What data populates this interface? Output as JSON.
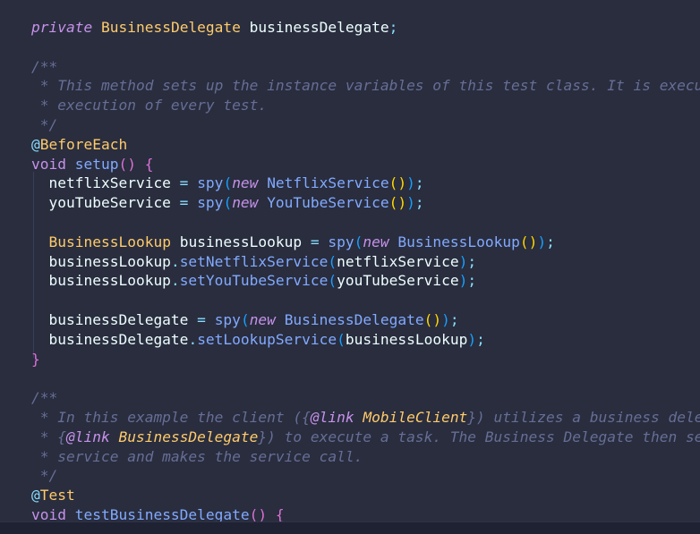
{
  "editor": {
    "lines": [
      {
        "tokens": [
          {
            "t": "private",
            "c": "tk-kwi"
          },
          {
            "t": " "
          },
          {
            "t": "BusinessDelegate",
            "c": "tk-type"
          },
          {
            "t": " businessDelegate",
            "c": "tk-id"
          },
          {
            "t": ";",
            "c": "tk-punc"
          }
        ]
      },
      {
        "tokens": []
      },
      {
        "tokens": [
          {
            "t": "/**",
            "c": "tk-comment"
          }
        ]
      },
      {
        "tokens": [
          {
            "t": " * This method sets up the instance variables of this test class. It is executed before the",
            "c": "tk-comment"
          }
        ]
      },
      {
        "tokens": [
          {
            "t": " * execution of every test.",
            "c": "tk-comment"
          }
        ]
      },
      {
        "tokens": [
          {
            "t": " */",
            "c": "tk-comment"
          }
        ]
      },
      {
        "tokens": [
          {
            "t": "@",
            "c": "tk-ann-at"
          },
          {
            "t": "BeforeEach",
            "c": "tk-ann"
          }
        ]
      },
      {
        "tokens": [
          {
            "t": "void",
            "c": "tk-kw"
          },
          {
            "t": " "
          },
          {
            "t": "setup",
            "c": "tk-fn"
          },
          {
            "t": "()",
            "c": "tk-paren2"
          },
          {
            "t": " "
          },
          {
            "t": "{",
            "c": "tk-paren2"
          }
        ]
      },
      {
        "tokens": [
          {
            "t": "  netflixService",
            "c": "tk-id"
          },
          {
            "t": " = ",
            "c": "tk-op"
          },
          {
            "t": "spy",
            "c": "tk-fn"
          },
          {
            "t": "(",
            "c": "tk-paren3"
          },
          {
            "t": "new",
            "c": "tk-kwi"
          },
          {
            "t": " "
          },
          {
            "t": "NetflixService",
            "c": "tk-fn"
          },
          {
            "t": "()",
            "c": "tk-paren"
          },
          {
            "t": ")",
            "c": "tk-paren3"
          },
          {
            "t": ";",
            "c": "tk-punc"
          }
        ]
      },
      {
        "tokens": [
          {
            "t": "  youTubeService",
            "c": "tk-id"
          },
          {
            "t": " = ",
            "c": "tk-op"
          },
          {
            "t": "spy",
            "c": "tk-fn"
          },
          {
            "t": "(",
            "c": "tk-paren3"
          },
          {
            "t": "new",
            "c": "tk-kwi"
          },
          {
            "t": " "
          },
          {
            "t": "YouTubeService",
            "c": "tk-fn"
          },
          {
            "t": "()",
            "c": "tk-paren"
          },
          {
            "t": ")",
            "c": "tk-paren3"
          },
          {
            "t": ";",
            "c": "tk-punc"
          }
        ]
      },
      {
        "tokens": []
      },
      {
        "tokens": [
          {
            "t": "  "
          },
          {
            "t": "BusinessLookup",
            "c": "tk-type"
          },
          {
            "t": " businessLookup",
            "c": "tk-id"
          },
          {
            "t": " = ",
            "c": "tk-op"
          },
          {
            "t": "spy",
            "c": "tk-fn"
          },
          {
            "t": "(",
            "c": "tk-paren3"
          },
          {
            "t": "new",
            "c": "tk-kwi"
          },
          {
            "t": " "
          },
          {
            "t": "BusinessLookup",
            "c": "tk-fn"
          },
          {
            "t": "()",
            "c": "tk-paren"
          },
          {
            "t": ")",
            "c": "tk-paren3"
          },
          {
            "t": ";",
            "c": "tk-punc"
          }
        ]
      },
      {
        "tokens": [
          {
            "t": "  businessLookup",
            "c": "tk-id"
          },
          {
            "t": ".",
            "c": "tk-punc"
          },
          {
            "t": "setNetflixService",
            "c": "tk-fn"
          },
          {
            "t": "(",
            "c": "tk-paren3"
          },
          {
            "t": "netflixService",
            "c": "tk-id"
          },
          {
            "t": ")",
            "c": "tk-paren3"
          },
          {
            "t": ";",
            "c": "tk-punc"
          }
        ]
      },
      {
        "tokens": [
          {
            "t": "  businessLookup",
            "c": "tk-id"
          },
          {
            "t": ".",
            "c": "tk-punc"
          },
          {
            "t": "setYouTubeService",
            "c": "tk-fn"
          },
          {
            "t": "(",
            "c": "tk-paren3"
          },
          {
            "t": "youTubeService",
            "c": "tk-id"
          },
          {
            "t": ")",
            "c": "tk-paren3"
          },
          {
            "t": ";",
            "c": "tk-punc"
          }
        ]
      },
      {
        "tokens": []
      },
      {
        "tokens": [
          {
            "t": "  businessDelegate",
            "c": "tk-id"
          },
          {
            "t": " = ",
            "c": "tk-op"
          },
          {
            "t": "spy",
            "c": "tk-fn"
          },
          {
            "t": "(",
            "c": "tk-paren3"
          },
          {
            "t": "new",
            "c": "tk-kwi"
          },
          {
            "t": " "
          },
          {
            "t": "BusinessDelegate",
            "c": "tk-fn"
          },
          {
            "t": "()",
            "c": "tk-paren"
          },
          {
            "t": ")",
            "c": "tk-paren3"
          },
          {
            "t": ";",
            "c": "tk-punc"
          }
        ]
      },
      {
        "tokens": [
          {
            "t": "  businessDelegate",
            "c": "tk-id"
          },
          {
            "t": ".",
            "c": "tk-punc"
          },
          {
            "t": "setLookupService",
            "c": "tk-fn"
          },
          {
            "t": "(",
            "c": "tk-paren3"
          },
          {
            "t": "businessLookup",
            "c": "tk-id"
          },
          {
            "t": ")",
            "c": "tk-paren3"
          },
          {
            "t": ";",
            "c": "tk-punc"
          }
        ]
      },
      {
        "tokens": [
          {
            "t": "}",
            "c": "tk-paren2"
          }
        ]
      },
      {
        "tokens": []
      },
      {
        "tokens": [
          {
            "t": "/**",
            "c": "tk-comment"
          }
        ]
      },
      {
        "tokens": [
          {
            "t": " * In this example the client ({",
            "c": "tk-comment"
          },
          {
            "t": "@link",
            "c": "tk-doctag"
          },
          {
            "t": " "
          },
          {
            "t": "MobileClient",
            "c": "tk-doctype"
          },
          {
            "t": "}) utilizes a business delegate",
            "c": "tk-comment"
          }
        ]
      },
      {
        "tokens": [
          {
            "t": " * {",
            "c": "tk-comment"
          },
          {
            "t": "@link",
            "c": "tk-doctag"
          },
          {
            "t": " "
          },
          {
            "t": "BusinessDelegate",
            "c": "tk-doctype"
          },
          {
            "t": "}) to execute a task. The Business Delegate then selects the appropriate",
            "c": "tk-comment"
          }
        ]
      },
      {
        "tokens": [
          {
            "t": " * service and makes the service call.",
            "c": "tk-comment"
          }
        ]
      },
      {
        "tokens": [
          {
            "t": " */",
            "c": "tk-comment"
          }
        ]
      },
      {
        "tokens": [
          {
            "t": "@",
            "c": "tk-ann-at"
          },
          {
            "t": "Test",
            "c": "tk-ann"
          }
        ]
      },
      {
        "tokens": [
          {
            "t": "void",
            "c": "tk-kw"
          },
          {
            "t": " "
          },
          {
            "t": "testBusinessDelegate",
            "c": "tk-fn"
          },
          {
            "t": "()",
            "c": "tk-paren2"
          },
          {
            "t": " "
          },
          {
            "t": "{",
            "c": "tk-paren2"
          }
        ]
      }
    ]
  }
}
